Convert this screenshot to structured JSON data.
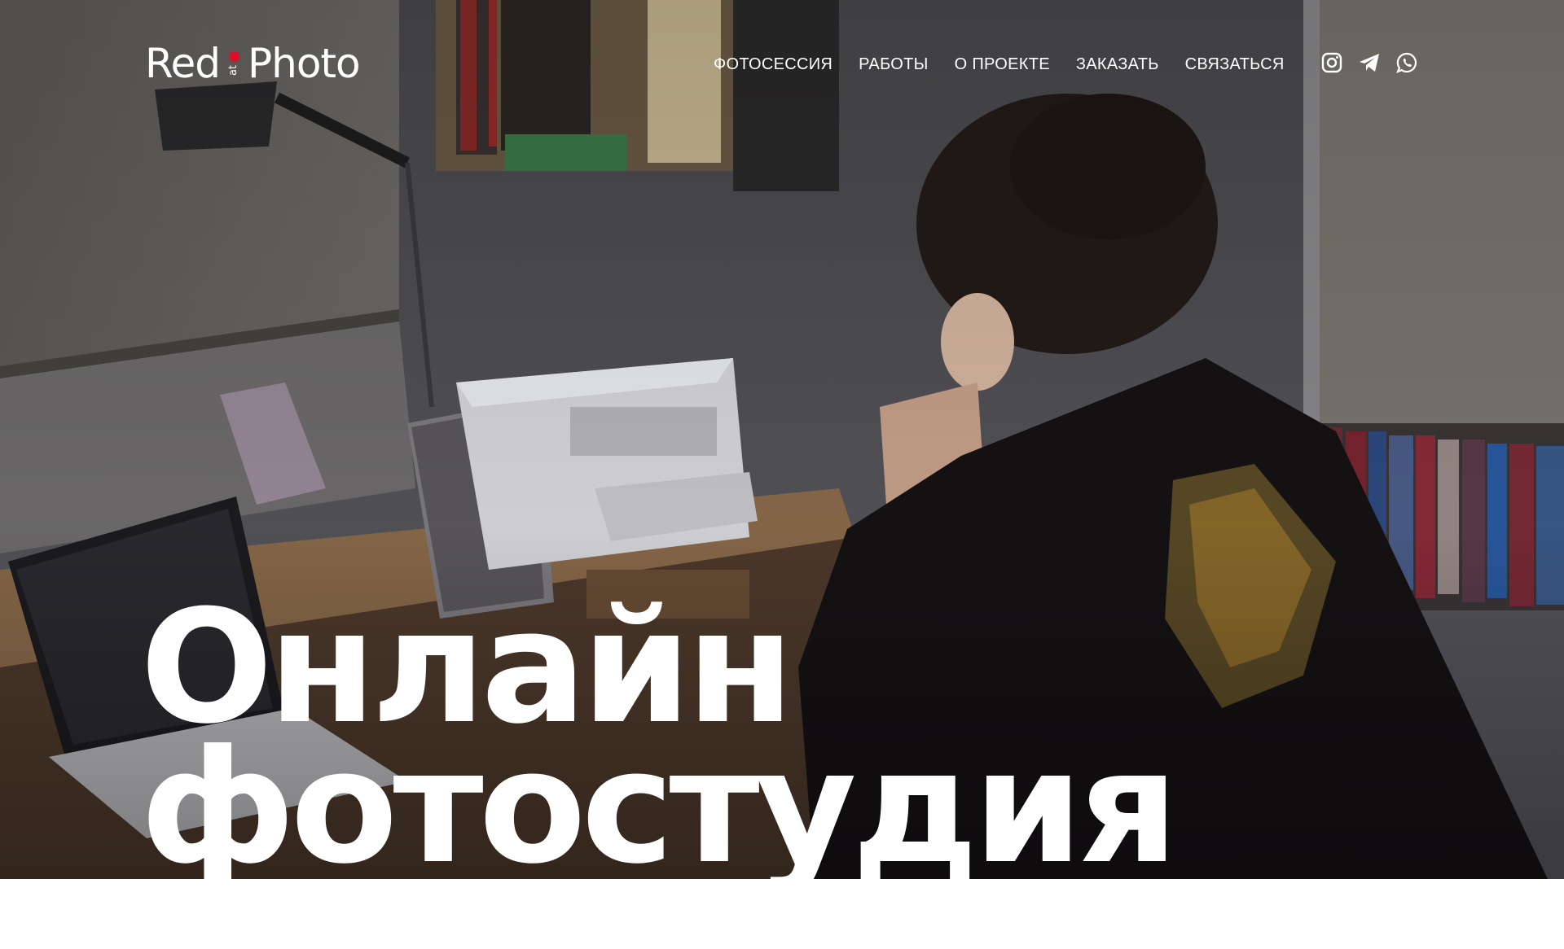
{
  "header": {
    "logo": {
      "part1": "Red",
      "mark": "at",
      "part2": "Photo"
    },
    "nav": [
      "ФОТОСЕССИЯ",
      "РАБОТЫ",
      "О ПРОЕКТЕ",
      "ЗАКАЗАТЬ",
      "СВЯЗАТЬСЯ"
    ],
    "socials": [
      "instagram-icon",
      "telegram-icon",
      "whatsapp-icon"
    ]
  },
  "hero": {
    "headline_line1": "Онлайн",
    "headline_line2": "фотостудия"
  },
  "colors": {
    "accent": "#d8102a",
    "text": "#ffffff"
  }
}
